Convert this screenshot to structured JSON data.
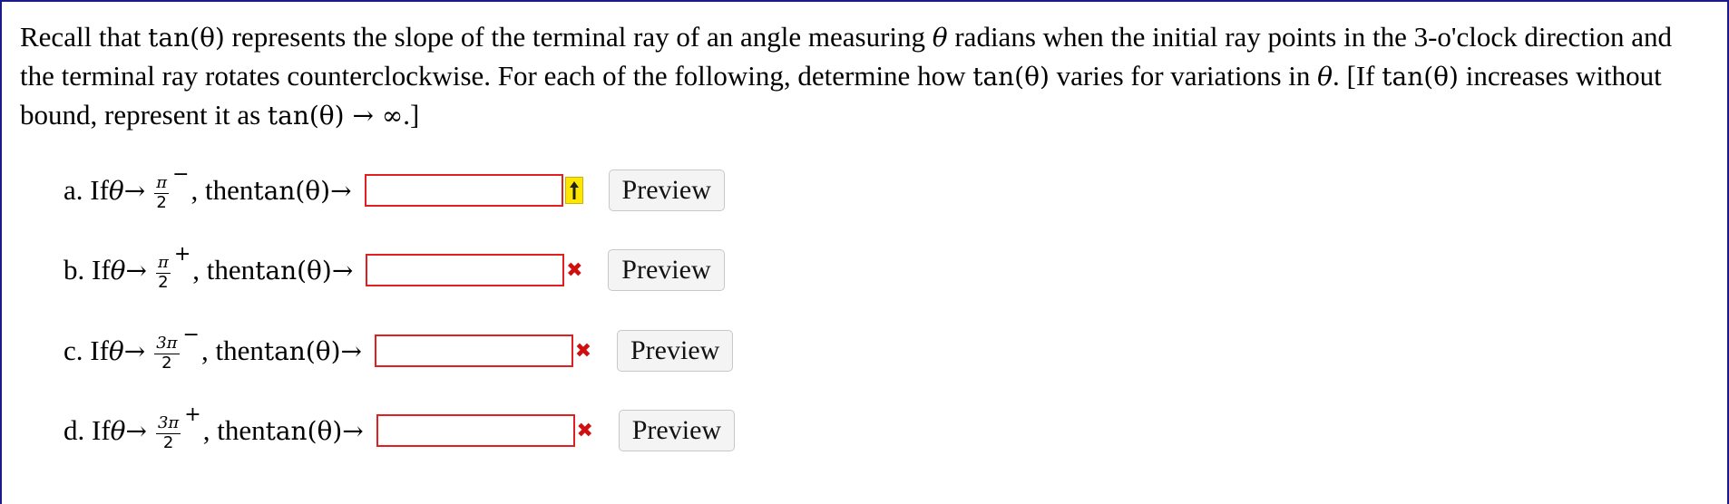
{
  "intro": {
    "t1": "Recall that ",
    "tan_theta": "tan(θ)",
    "t2": " represents the slope of the terminal ray of an angle measuring ",
    "theta": "θ",
    "t3": " radians when the initial ray points in the 3-o'clock direction and the terminal ray rotates counterclockwise. For each of the following, determine how ",
    "t4": " varies for variations in ",
    "t5": ". [If ",
    "t6": " increases without bound, represent it as ",
    "arrow_inf": " → ∞",
    "t7": ".]"
  },
  "rows": [
    {
      "label": "a. If ",
      "num": "π",
      "den": "2",
      "sign": "−",
      "then": ", then ",
      "value": "",
      "status_icon": "arrow-up-icon",
      "preview": "Preview"
    },
    {
      "label": "b. If ",
      "num": "π",
      "den": "2",
      "sign": "+",
      "then": ", then ",
      "value": "",
      "status_icon": "x-icon",
      "preview": "Preview"
    },
    {
      "label": "c. If ",
      "num": "3π",
      "den": "2",
      "sign": "−",
      "then": ", then ",
      "value": "",
      "status_icon": "x-icon",
      "preview": "Preview"
    },
    {
      "label": "d. If ",
      "num": "3π",
      "den": "2",
      "sign": "+",
      "then": ", then ",
      "value": "",
      "status_icon": "x-icon",
      "preview": "Preview"
    }
  ],
  "symbols": {
    "theta": "θ",
    "arrow": " → ",
    "tan_theta": "tan(θ)",
    "up_arrow": "↑",
    "x_mark": "✖"
  },
  "colors": {
    "frame": "#1a1a8c",
    "error_border": "#e02020",
    "flag_yellow": "#ffe600",
    "x_red": "#d01010"
  }
}
